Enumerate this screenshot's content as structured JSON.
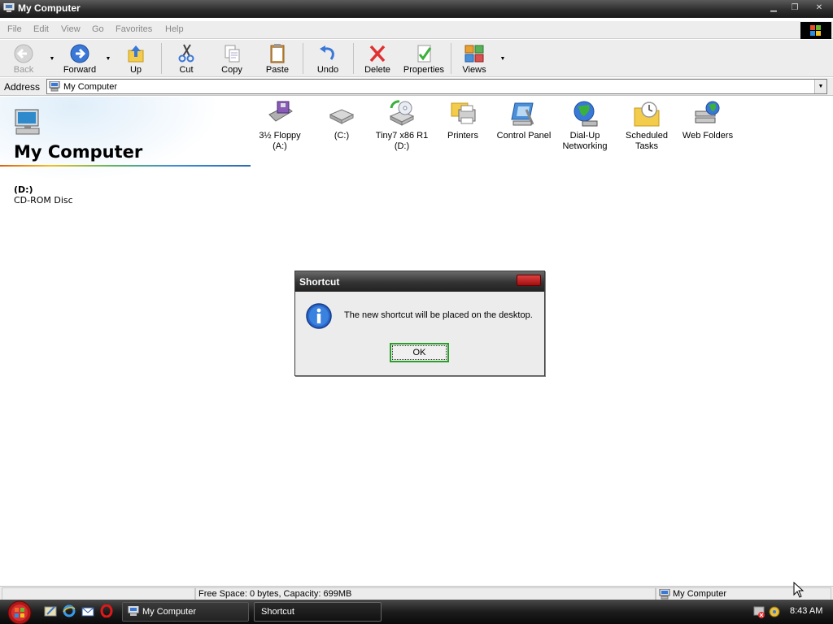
{
  "window": {
    "title": "My Computer"
  },
  "menu": [
    "File",
    "Edit",
    "View",
    "Go",
    "Favorites",
    "Help"
  ],
  "toolbar": {
    "back": "Back",
    "forward": "Forward",
    "up": "Up",
    "cut": "Cut",
    "copy": "Copy",
    "paste": "Paste",
    "undo": "Undo",
    "delete": "Delete",
    "properties": "Properties",
    "views": "Views"
  },
  "address": {
    "label": "Address",
    "value": "My Computer"
  },
  "left_pane": {
    "title": "My Computer",
    "selected_name": "(D:)",
    "selected_desc": "CD-ROM Disc"
  },
  "items": [
    {
      "line1": "3½ Floppy",
      "line2": "(A:)",
      "icon": "floppy-icon"
    },
    {
      "line1": "(C:)",
      "line2": "",
      "icon": "hard-drive-icon"
    },
    {
      "line1": "Tiny7 x86 R1",
      "line2": "(D:)",
      "icon": "cd-drive-icon"
    },
    {
      "line1": "Printers",
      "line2": "",
      "icon": "printers-icon"
    },
    {
      "line1": "Control Panel",
      "line2": "",
      "icon": "control-panel-icon"
    },
    {
      "line1": "Dial-Up",
      "line2": "Networking",
      "icon": "dial-up-icon"
    },
    {
      "line1": "Scheduled",
      "line2": "Tasks",
      "icon": "scheduled-tasks-icon"
    },
    {
      "line1": "Web Folders",
      "line2": "",
      "icon": "web-folders-icon"
    }
  ],
  "status": {
    "left": "",
    "middle": "Free Space: 0 bytes, Capacity: 699MB",
    "right": "My Computer"
  },
  "dialog": {
    "title": "Shortcut",
    "message": "The new shortcut will be placed on the desktop.",
    "ok": "OK"
  },
  "taskbar": {
    "tasks": [
      "My Computer",
      "Shortcut"
    ],
    "clock": "8:43 AM"
  }
}
